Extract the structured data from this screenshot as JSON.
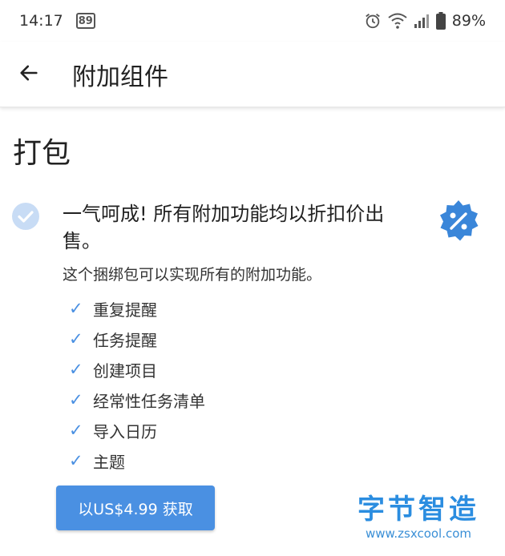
{
  "status_bar": {
    "time": "14:17",
    "notification_badge": "89",
    "battery": "89%",
    "icons": [
      "alarm-icon",
      "wifi-icon",
      "signal-icon",
      "battery-icon"
    ]
  },
  "app_bar": {
    "title": "附加组件",
    "back_icon": "arrow-left-icon"
  },
  "section": {
    "title": "打包"
  },
  "bundle": {
    "headline": "一气呵成! 所有附加功能均以折扣价出售。",
    "description": "这个捆绑包可以实现所有的附加功能。",
    "features": [
      {
        "check": "✓",
        "label": "重复提醒"
      },
      {
        "check": "✓",
        "label": "任务提醒"
      },
      {
        "check": "✓",
        "label": "创建项目"
      },
      {
        "check": "✓",
        "label": "经常性任务清单"
      },
      {
        "check": "✓",
        "label": "导入日历"
      },
      {
        "check": "✓",
        "label": "主题"
      }
    ],
    "buy_button_label": "以US$4.99 获取",
    "discount_icon": "percent-badge-icon"
  },
  "watermark": {
    "title": "字节智造",
    "url": "www.zsxcool.com"
  },
  "colors": {
    "accent": "#4a90e2",
    "check_circle": "#c8dcf5",
    "badge": "#3a86d9"
  }
}
